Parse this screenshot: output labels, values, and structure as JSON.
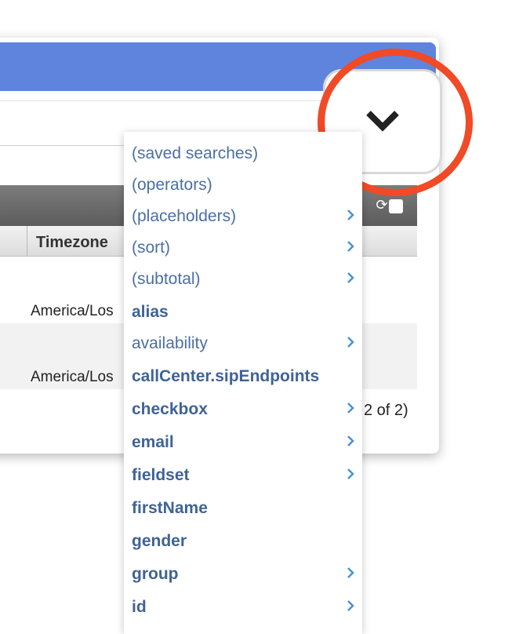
{
  "table": {
    "column_header": "Timezone",
    "rows": [
      {
        "timezone": "America/Los"
      },
      {
        "timezone": "America/Los"
      }
    ],
    "pager": "2 of 2)"
  },
  "dropdown": {
    "items": [
      {
        "label": "(saved searches)",
        "bold": false,
        "submenu": false
      },
      {
        "label": "(operators)",
        "bold": false,
        "submenu": false
      },
      {
        "label": "(placeholders)",
        "bold": false,
        "submenu": true
      },
      {
        "label": "(sort)",
        "bold": false,
        "submenu": true
      },
      {
        "label": "(subtotal)",
        "bold": false,
        "submenu": true
      },
      {
        "label": "alias",
        "bold": true,
        "submenu": false
      },
      {
        "label": "availability",
        "bold": false,
        "submenu": true
      },
      {
        "label": "callCenter.sipEndpoints",
        "bold": true,
        "submenu": false
      },
      {
        "label": "checkbox",
        "bold": true,
        "submenu": true
      },
      {
        "label": "email",
        "bold": true,
        "submenu": true
      },
      {
        "label": "fieldset",
        "bold": true,
        "submenu": true
      },
      {
        "label": "firstName",
        "bold": true,
        "submenu": false
      },
      {
        "label": "gender",
        "bold": true,
        "submenu": false
      },
      {
        "label": "group",
        "bold": true,
        "submenu": true
      },
      {
        "label": "id",
        "bold": true,
        "submenu": true
      }
    ]
  },
  "colors": {
    "title_bar": "#5f84dd",
    "highlight_ring": "#f04a26",
    "menu_text": "#4a6fa5"
  },
  "icons": {
    "trigger": "chevron-down-icon",
    "submenu": "chevron-right-icon",
    "refresh": "refresh-icon"
  }
}
